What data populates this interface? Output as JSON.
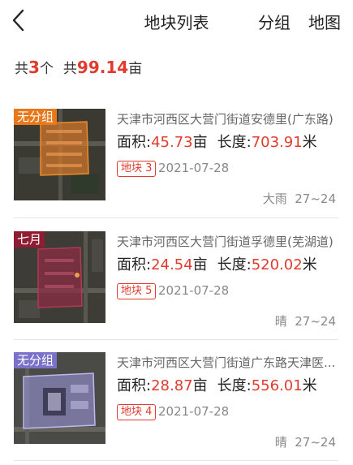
{
  "nav": {
    "title": "地块列表",
    "group_label": "分组",
    "map_label": "地图"
  },
  "summary": {
    "count_prefix": "共",
    "count": "3",
    "count_unit": "个",
    "area_prefix": "共",
    "area": "99.14",
    "area_unit": "亩"
  },
  "colors": {
    "accent": "#e23b2e"
  },
  "plots": [
    {
      "group_tag": "无分组",
      "tag_color": "#e8781c",
      "address": "天津市河西区大营门街道安德里(广东路)",
      "area_label": "面积:",
      "area_value": "45.73",
      "area_unit": "亩",
      "length_label": "长度:",
      "length_value": "703.91",
      "length_unit": "米",
      "plot_badge": "地块 3",
      "date": "2021-07-28",
      "weather": "大雨",
      "temperature": "27~24"
    },
    {
      "group_tag": "七月",
      "tag_color": "#8e1d34",
      "address": "天津市河西区大营门街道孚德里(芜湖道)",
      "area_label": "面积:",
      "area_value": "24.54",
      "area_unit": "亩",
      "length_label": "长度:",
      "length_value": "520.02",
      "length_unit": "米",
      "plot_badge": "地块 5",
      "date": "2021-07-28",
      "weather": "晴",
      "temperature": "27~24"
    },
    {
      "group_tag": "无分组",
      "tag_color": "#7a72c9",
      "address": "天津市河西区大营门街道广东路天津医...",
      "area_label": "面积:",
      "area_value": "28.87",
      "area_unit": "亩",
      "length_label": "长度:",
      "length_value": "556.01",
      "length_unit": "米",
      "plot_badge": "地块 4",
      "date": "2021-07-28",
      "weather": "晴",
      "temperature": "27~24"
    }
  ]
}
